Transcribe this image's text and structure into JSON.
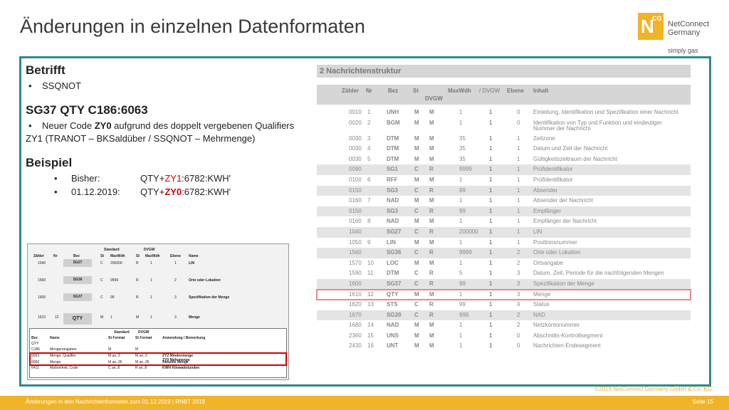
{
  "title": "Änderungen in einzelnen Datenformaten",
  "logo": {
    "mark": "N",
    "sup": "CG",
    "name1": "NetConnect",
    "name2": "Germany",
    "slogan": "simply gas"
  },
  "left": {
    "h1": "Betrifft",
    "b1": "SSQNOT",
    "h2": "SG37 QTY C186:6063",
    "b2_pre": "Neuer Code ",
    "b2_code": "ZY0",
    "b2_post": " aufgrund des doppelt vergebenen Qualifiers",
    "b2_line2": "ZY1 (TRANOT – BKSaldüber / SSQNOT – Mehrmenge)",
    "h3": "Beispiel",
    "ex1_label": "Bisher:",
    "ex1_pre": "QTY+",
    "ex1_code": "ZY1",
    "ex1_post": ":6782:KWH'",
    "ex2_label": "01.12.2019:",
    "ex2_pre": "QTY+",
    "ex2_code": "ZY0",
    "ex2_post": ":6782:KWH'"
  },
  "right": {
    "title": "2 Nachrichtenstruktur",
    "headers": {
      "zaehler": "Zähler",
      "nr": "Nr",
      "bez": "Bez",
      "st": "St",
      "st2": "DVGW",
      "max": "MaxWdh",
      "dvgw": "/ DVGW",
      "ebene": "Ebene",
      "inhalt": "Inhalt"
    },
    "rows": [
      {
        "z": "0010",
        "n": "1",
        "b": "UNH",
        "s": "M",
        "s2": "M",
        "m": "1",
        "d": "1",
        "e": "0",
        "i": "Einleitung, Identifikation und Spezifikation einer Nachricht",
        "shade": false
      },
      {
        "z": "0020",
        "n": "2",
        "b": "BGM",
        "s": "M",
        "s2": "M",
        "m": "1",
        "d": "1",
        "e": "0",
        "i": "Identifikation von Typ und Funktion und eindeutiger",
        "i2": "Nummer der Nachricht",
        "shade": false
      },
      {
        "z": "0030",
        "n": "3",
        "b": "DTM",
        "s": "M",
        "s2": "M",
        "m": "35",
        "d": "1",
        "e": "1",
        "i": "Zeitzone",
        "shade": false
      },
      {
        "z": "0030",
        "n": "4",
        "b": "DTM",
        "s": "M",
        "s2": "M",
        "m": "35",
        "d": "1",
        "e": "1",
        "i": "Datum und Zeit der Nachricht",
        "shade": false
      },
      {
        "z": "0030",
        "n": "5",
        "b": "DTM",
        "s": "M",
        "s2": "M",
        "m": "35",
        "d": "1",
        "e": "1",
        "i": "Gültigkeitszeitraum der Nachricht",
        "shade": false
      },
      {
        "z": "0090",
        "n": "",
        "b": "SG1",
        "s": "C",
        "s2": "R",
        "m": "9999",
        "d": "1",
        "e": "1",
        "i": "Prüfidentifikator",
        "shade": true
      },
      {
        "z": "0100",
        "n": "6",
        "b": "RFF",
        "s": "M",
        "s2": "M",
        "m": "1",
        "d": "1",
        "e": "1",
        "i": "Prüfidentifikator",
        "shade": false
      },
      {
        "z": "0150",
        "n": "",
        "b": "SG3",
        "s": "C",
        "s2": "R",
        "m": "99",
        "d": "1",
        "e": "1",
        "i": "Absender",
        "shade": true
      },
      {
        "z": "0160",
        "n": "7",
        "b": "NAD",
        "s": "M",
        "s2": "M",
        "m": "1",
        "d": "1",
        "e": "1",
        "i": "Absender der Nachricht",
        "shade": false
      },
      {
        "z": "0150",
        "n": "",
        "b": "SG3",
        "s": "C",
        "s2": "R",
        "m": "99",
        "d": "1",
        "e": "1",
        "i": "Empfänger",
        "shade": true
      },
      {
        "z": "0160",
        "n": "8",
        "b": "NAD",
        "s": "M",
        "s2": "M",
        "m": "1",
        "d": "1",
        "e": "1",
        "i": "Empfänger der Nachricht",
        "shade": false
      },
      {
        "z": "1040",
        "n": "",
        "b": "SG27",
        "s": "C",
        "s2": "R",
        "m": "200000",
        "d": "1",
        "e": "1",
        "i": "LIN",
        "shade": true
      },
      {
        "z": "1050",
        "n": "9",
        "b": "LIN",
        "s": "M",
        "s2": "M",
        "m": "1",
        "d": "1",
        "e": "1",
        "i": "Positionsnummer",
        "shade": false
      },
      {
        "z": "1560",
        "n": "",
        "b": "SG36",
        "s": "C",
        "s2": "R",
        "m": "9999",
        "d": "1",
        "e": "2",
        "i": "Orte oder Lokation",
        "shade": true
      },
      {
        "z": "1570",
        "n": "10",
        "b": "LOC",
        "s": "M",
        "s2": "M",
        "m": "1",
        "d": "1",
        "e": "2",
        "i": "Ortsangabe",
        "shade": false
      },
      {
        "z": "1590",
        "n": "11",
        "b": "DTM",
        "s": "C",
        "s2": "R",
        "m": "5",
        "d": "1",
        "e": "3",
        "i": "Datum, Zeit, Periode für die nachfolgenden Mengen",
        "shade": false
      },
      {
        "z": "1600",
        "n": "",
        "b": "SG37",
        "s": "C",
        "s2": "R",
        "m": "99",
        "d": "1",
        "e": "3",
        "i": "Spezifikation der Menge",
        "shade": true
      },
      {
        "z": "1610",
        "n": "12",
        "b": "QTY",
        "s": "M",
        "s2": "M",
        "m": "1",
        "d": "1",
        "e": "3",
        "i": "Menge",
        "shade": false,
        "hl": true
      },
      {
        "z": "1620",
        "n": "13",
        "b": "STS",
        "s": "C",
        "s2": "R",
        "m": "99",
        "d": "1",
        "e": "4",
        "i": "Status",
        "shade": false
      },
      {
        "z": "1670",
        "n": "",
        "b": "SG39",
        "s": "C",
        "s2": "R",
        "m": "999",
        "d": "1",
        "e": "2",
        "i": "NAD",
        "shade": true
      },
      {
        "z": "1680",
        "n": "14",
        "b": "NAD",
        "s": "M",
        "s2": "M",
        "m": "1",
        "d": "1",
        "e": "2",
        "i": "Netzkontonummer",
        "shade": false
      },
      {
        "z": "2360",
        "n": "15",
        "b": "UNS",
        "s": "M",
        "s2": "M",
        "m": "1",
        "d": "1",
        "e": "0",
        "i": "Abschnitts-Kontrollsegment",
        "shade": false
      },
      {
        "z": "2430",
        "n": "16",
        "b": "UNT",
        "s": "M",
        "s2": "M",
        "m": "1",
        "d": "1",
        "e": "0",
        "i": "Nachrichten-Endesegment",
        "shade": false
      }
    ]
  },
  "inset": {
    "head1": {
      "standard": "Standard",
      "dvgw": "DVGW"
    },
    "head2": {
      "zaehler": "Zähler",
      "nr": "Nr",
      "bez": "Bez",
      "st": "St",
      "max": "MaxWdh",
      "st2": "St",
      "max2": "MaxWdh",
      "ebene": "Ebene",
      "name": "Name"
    },
    "rows": [
      {
        "z": "1040",
        "n": "",
        "b": "SG27",
        "s": "C",
        "m": "200000",
        "s2": "R",
        "m2": "1",
        "e": "1",
        "name": "LIN"
      },
      {
        "z": "1560",
        "n": "",
        "b": "SG36",
        "s": "C",
        "m": "9999",
        "s2": "R",
        "m2": "1",
        "e": "2",
        "name": "Orte oder Lokation"
      },
      {
        "z": "1600",
        "n": "",
        "b": "SG37",
        "s": "C",
        "m": "99",
        "s2": "R",
        "m2": "1",
        "e": "3",
        "name": "Spezifikation der Menge"
      },
      {
        "z": "1610",
        "n": "12",
        "b": "QTY",
        "s": "M",
        "m": "1",
        "s2": "M",
        "m2": "1",
        "e": "3",
        "name": "Menge"
      }
    ],
    "sub_head1": {
      "standard": "Standard",
      "dvgw": "DVGW"
    },
    "sub_head2": {
      "bez": "Bez",
      "name": "Name",
      "stformat": "St Format",
      "stformat2": "St Format",
      "anw": "Anwendung / Bemerkung"
    },
    "sub_rows": [
      {
        "bez": "QTY",
        "name": "",
        "f1": "",
        "f2": "",
        "a": ""
      },
      {
        "bez": "C186",
        "name": "Mengenangaben",
        "f1": "M",
        "f2": "M",
        "a": ""
      },
      {
        "bez": "6063",
        "name": "Menge, Qualifier",
        "f1": "M an..3",
        "f2": "M an..3",
        "a": "ZY2 Mindermenge",
        "a2": "ZY0 Mehrmenge"
      },
      {
        "bez": "6060",
        "name": "Menge",
        "f1": "M an..35",
        "f2": "M an..35",
        "a": "Aktuelle Menge"
      },
      {
        "bez": "6411",
        "name": "Maßeinheit, Code",
        "f1": "C an..8",
        "f2": "R an..8",
        "a": "KWH Kilowattstunden"
      }
    ]
  },
  "footer": {
    "left": "Änderungen in den Nachrichtenformaten zum 01.12.2019  |  RNBT 2019",
    "right": "Seite 15",
    "copyright": "©2019 NetConnect Germany GmbH & Co. KG"
  },
  "colors": {
    "accent": "#f0b429",
    "frame": "#2e8a8f",
    "highlight": "#d40000"
  }
}
